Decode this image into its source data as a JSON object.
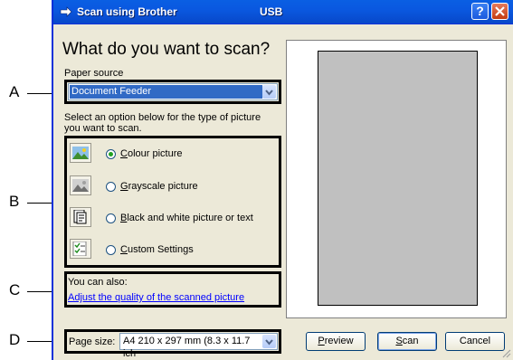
{
  "callouts": [
    "A",
    "B",
    "C",
    "D"
  ],
  "window": {
    "title": "Scan using Brother",
    "title_suffix": "USB",
    "help_button": "?",
    "close_button": "X"
  },
  "heading": "What do you want to scan?",
  "paper_source": {
    "label": "Paper source",
    "value": "Document Feeder"
  },
  "instruction": "Select an option below for the type of picture you want to scan.",
  "options": [
    {
      "label": "Colour picture",
      "accesskey": "C",
      "rest": "olour picture",
      "selected": true,
      "icon": "colour-picture-icon"
    },
    {
      "label": "Grayscale picture",
      "accesskey": "G",
      "rest": "rayscale picture",
      "selected": false,
      "icon": "grayscale-picture-icon"
    },
    {
      "label": "Black and white picture or text",
      "accesskey": "B",
      "rest": "lack and white picture or text",
      "selected": false,
      "icon": "black-white-text-icon"
    },
    {
      "label": "Custom Settings",
      "accesskey": "C",
      "rest": "ustom Settings",
      "selected": false,
      "icon": "custom-settings-icon"
    }
  ],
  "also": {
    "label": "You can also:",
    "link": "Adjust the quality of the scanned picture"
  },
  "page_size": {
    "label": "Page size:",
    "value": "A4 210 x 297 mm (8.3 x 11.7 ich"
  },
  "buttons": {
    "preview": {
      "accesskey": "P",
      "rest": "review"
    },
    "scan": {
      "accesskey": "S",
      "rest": "can"
    },
    "cancel": "Cancel"
  }
}
